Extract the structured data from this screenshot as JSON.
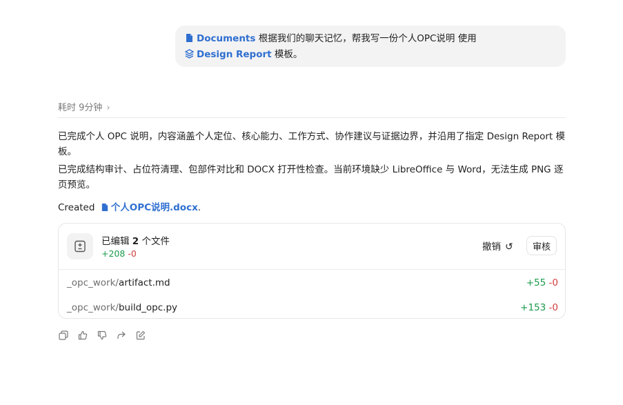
{
  "user_message": {
    "chip1_label": "Documents",
    "text_before_chip2": " 根据我们的聊天记忆，帮我写一份个人OPC说明 使用 ",
    "chip2_label": "Design Report",
    "text_after": " 模板。"
  },
  "elapsed": {
    "label": "耗时 9分钟"
  },
  "response": {
    "paragraph1": "已完成个人 OPC 说明，内容涵盖个人定位、核心能力、工作方式、协作建议与证据边界，并沿用了指定 Design Report 模板。",
    "paragraph2": "已完成结构审计、占位符清理、包部件对比和 DOCX 打开性检查。当前环境缺少 LibreOffice 与 Word，无法生成 PNG 逐页预览。",
    "created_prefix": "Created",
    "created_file": "个人OPC说明.docx",
    "created_suffix": "."
  },
  "changes_card": {
    "title_prefix": "已编辑 ",
    "title_count": "2",
    "title_suffix": " 个文件",
    "additions": "+208",
    "deletions": "-0",
    "undo_label": "撤销",
    "review_label": "审核",
    "files": [
      {
        "dir": "_opc_work/",
        "name": "artifact.md",
        "additions": "+55",
        "deletions": "-0"
      },
      {
        "dir": "_opc_work/",
        "name": "build_opc.py",
        "additions": "+153",
        "deletions": "-0"
      }
    ]
  },
  "actions": [
    "copy-icon",
    "thumbs-up-icon",
    "thumbs-down-icon",
    "share-icon",
    "edit-icon"
  ]
}
